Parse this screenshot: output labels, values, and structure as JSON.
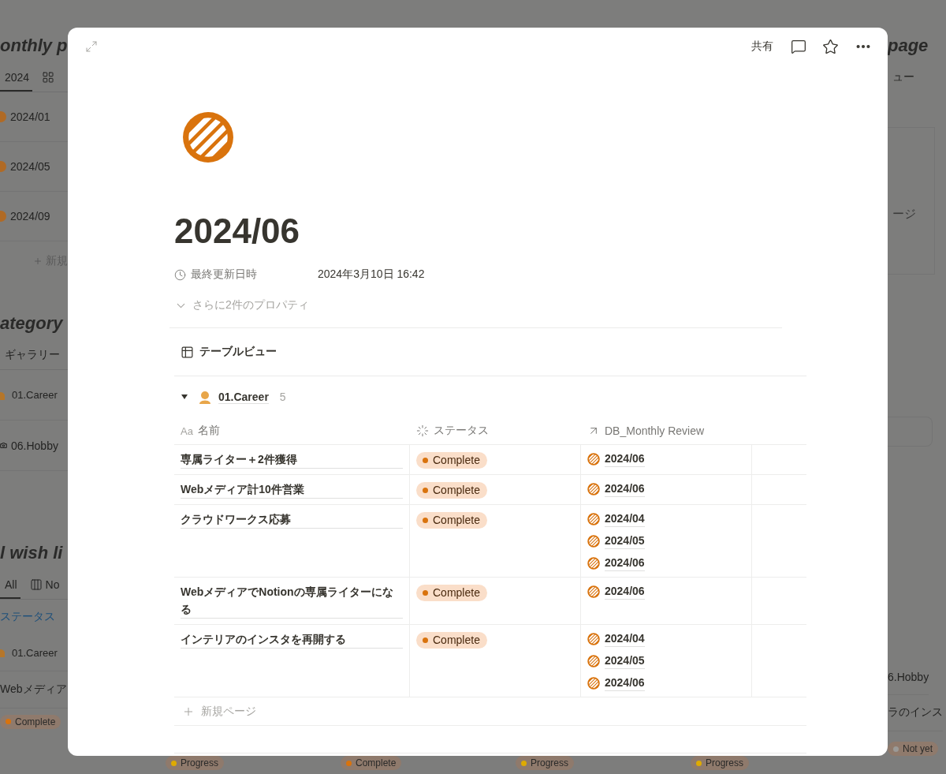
{
  "background": {
    "left": [
      {
        "heading": "onthly p",
        "tabs": [
          {
            "label": "2024",
            "selected": true
          },
          {
            "selected": false
          }
        ],
        "rows": [
          {
            "text": "2024/01"
          },
          {
            "text": "2024/05"
          },
          {
            "text": "2024/09"
          }
        ],
        "new": "新規"
      },
      {
        "heading": "ategory",
        "tabs": [
          {
            "label": "ギャラリー",
            "selected": false
          }
        ],
        "rows": [
          {
            "text": "01.Career"
          },
          {
            "text": "06.Hobby"
          }
        ]
      },
      {
        "heading": "l wish li",
        "tabs": [
          {
            "label": "All",
            "selected": true
          },
          {
            "label": "No",
            "selected": false
          }
        ],
        "filter": "ステータス",
        "rows": [
          {
            "text": "01.Career"
          },
          {
            "text": "Webメディア"
          }
        ],
        "tag": {
          "text": "Complete",
          "color": "#d9730d"
        }
      }
    ],
    "right": {
      "heading": "page",
      "tab": "ュー",
      "card_text": "ージ",
      "rows": [
        "6.Hobby",
        "ラのインス"
      ],
      "tag": {
        "text": "Not yet",
        "color": "#9b9a97"
      }
    },
    "bottom_tags": [
      {
        "text": "Progress",
        "color": "#dfab01"
      },
      {
        "text": "Complete",
        "color": "#d9730d"
      },
      {
        "text": "Progress",
        "color": "#dfab01"
      },
      {
        "text": "Progress",
        "color": "#dfab01"
      }
    ]
  },
  "modal": {
    "share": "共有",
    "title": "2024/06",
    "properties": [
      {
        "name": "最終更新日時",
        "value": "2024年3月10日 16:42"
      }
    ],
    "more_properties": "さらに2件のプロパティ",
    "view": "テーブルビュー",
    "group": {
      "name": "01.Career",
      "count": "5",
      "expanded": true
    },
    "columns": [
      {
        "kind": "text",
        "icon_text": "Aa",
        "label": "名前"
      },
      {
        "kind": "status",
        "label": "ステータス"
      },
      {
        "kind": "relation",
        "label": "DB_Monthly Review"
      }
    ],
    "rows": [
      {
        "name": "専属ライター＋2件獲得",
        "status": "Complete",
        "reviews": [
          "2024/06"
        ]
      },
      {
        "name": "Webメディア計10件営業",
        "status": "Complete",
        "reviews": [
          "2024/06"
        ]
      },
      {
        "name": "クラウドワークス応募",
        "status": "Complete",
        "reviews": [
          "2024/04",
          "2024/05",
          "2024/06"
        ]
      },
      {
        "name": "WebメディアでNotionの専属ライターになる",
        "status": "Complete",
        "reviews": [
          "2024/06"
        ]
      },
      {
        "name": "インテリアのインスタを再開する",
        "status": "Complete",
        "reviews": [
          "2024/04",
          "2024/05",
          "2024/06"
        ]
      }
    ],
    "new_page": "新規ページ"
  }
}
